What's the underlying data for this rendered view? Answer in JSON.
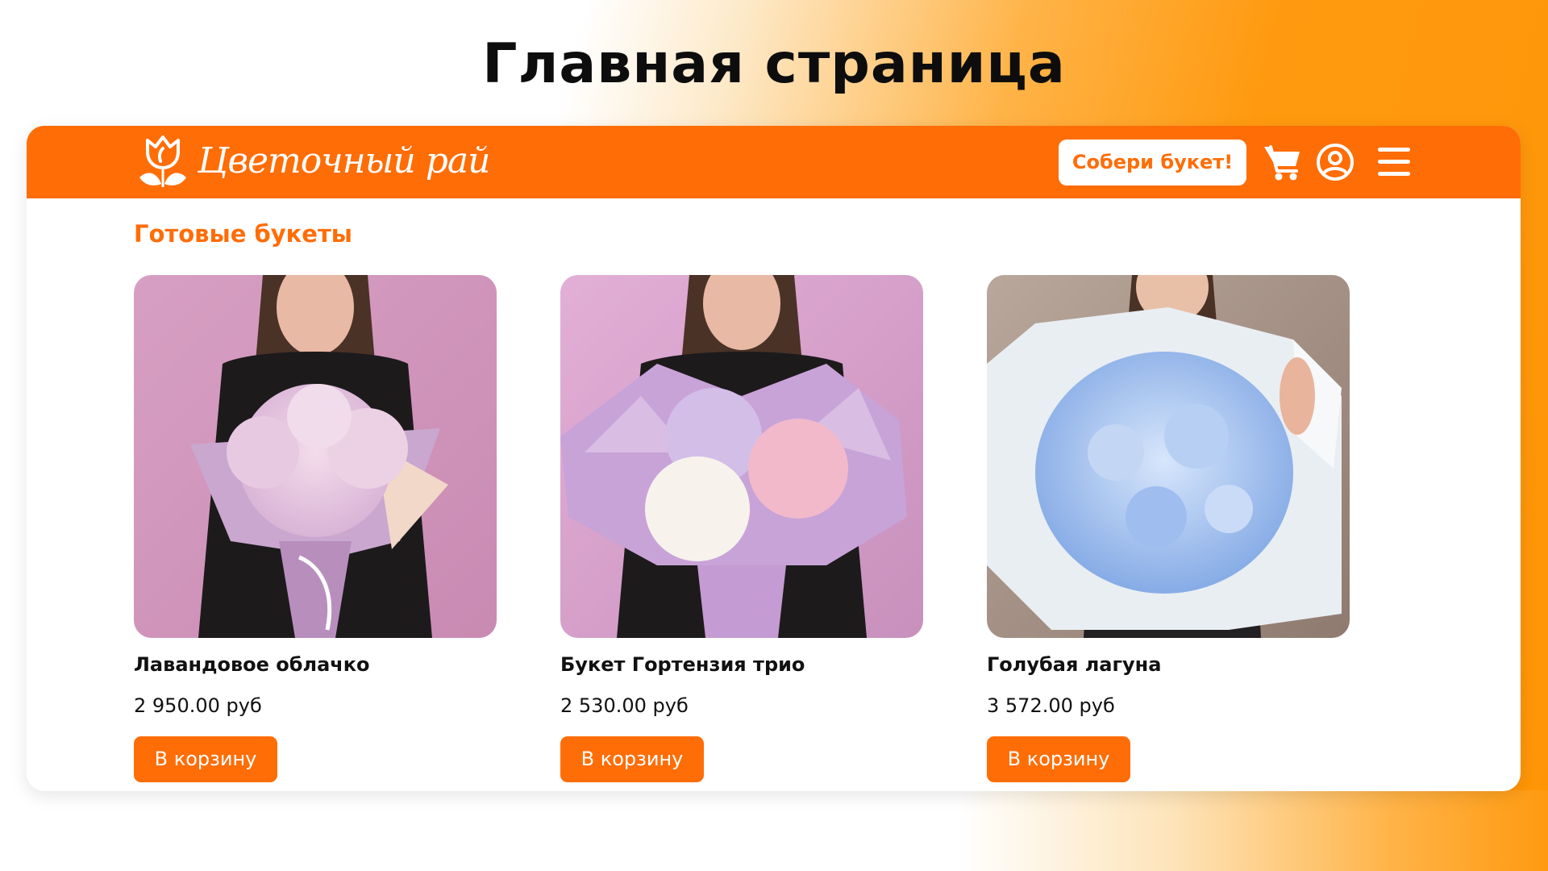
{
  "slide_title": "Главная страница",
  "header": {
    "logo_text": "Цветочный рай",
    "cta_label": "Собери букет!",
    "icons": [
      "tulip-logo-icon",
      "cart-icon",
      "user-icon",
      "menu-icon"
    ]
  },
  "catalog": {
    "section_title": "Готовые букеты",
    "products": [
      {
        "name": "Лавандовое облачко",
        "price": "2 950.00 руб",
        "button": "В корзину"
      },
      {
        "name": "Букет Гортензия трио",
        "price": "2 530.00 руб",
        "button": "В корзину"
      },
      {
        "name": "Голубая лагуна",
        "price": "3 572.00 руб",
        "button": "В корзину"
      }
    ]
  },
  "colors": {
    "accent": "#ff6d06",
    "gradient_end": "#ff9506",
    "card_bg_pink": "#d9a0c4",
    "card_bg_gray": "#b09c8f"
  }
}
